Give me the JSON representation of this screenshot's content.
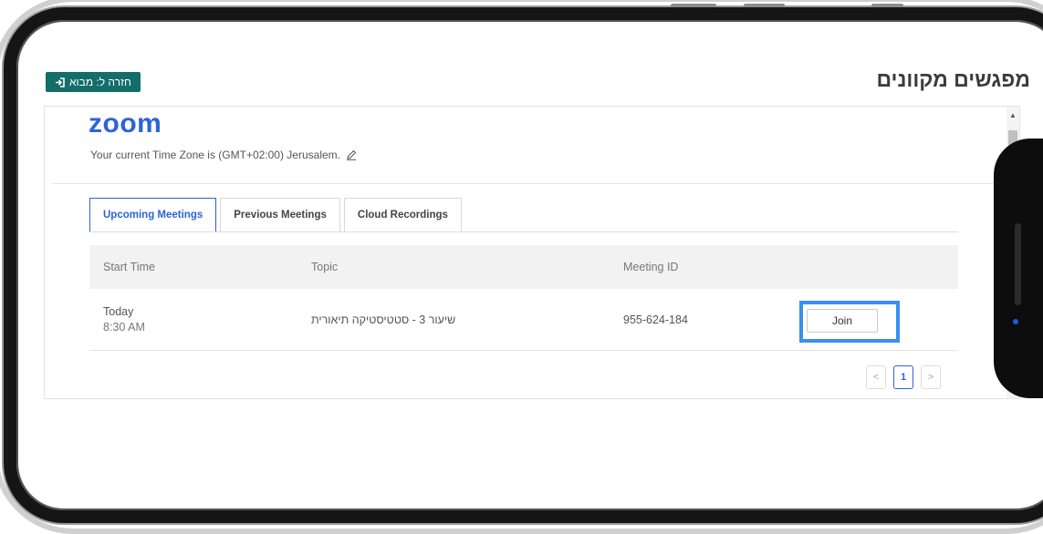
{
  "header": {
    "page_title": "מפגשים מקוונים",
    "back_button_label": "חזרה ל: מבוא",
    "back_icon": "sign-in-icon"
  },
  "zoom": {
    "logo": "zoom",
    "timezone_text": "Your current Time Zone is (GMT+02:00) Jerusalem.",
    "edit_icon": "pencil-icon"
  },
  "tabs": [
    {
      "label": "Upcoming Meetings",
      "active": true
    },
    {
      "label": "Previous Meetings",
      "active": false
    },
    {
      "label": "Cloud Recordings",
      "active": false
    }
  ],
  "table": {
    "columns": [
      "Start Time",
      "Topic",
      "Meeting ID",
      ""
    ],
    "rows": [
      {
        "day": "Today",
        "time": "8:30 AM",
        "topic": "שיעור 3 - סטטיסטיקה תיאורית",
        "meeting_id": "955-624-184",
        "action": "Join"
      }
    ]
  },
  "pagination": {
    "prev": "<",
    "current": "1",
    "next": ">"
  },
  "colors": {
    "accent": "#2d63d6",
    "back_button": "#126d6b",
    "highlight": "#3a8ff0"
  }
}
